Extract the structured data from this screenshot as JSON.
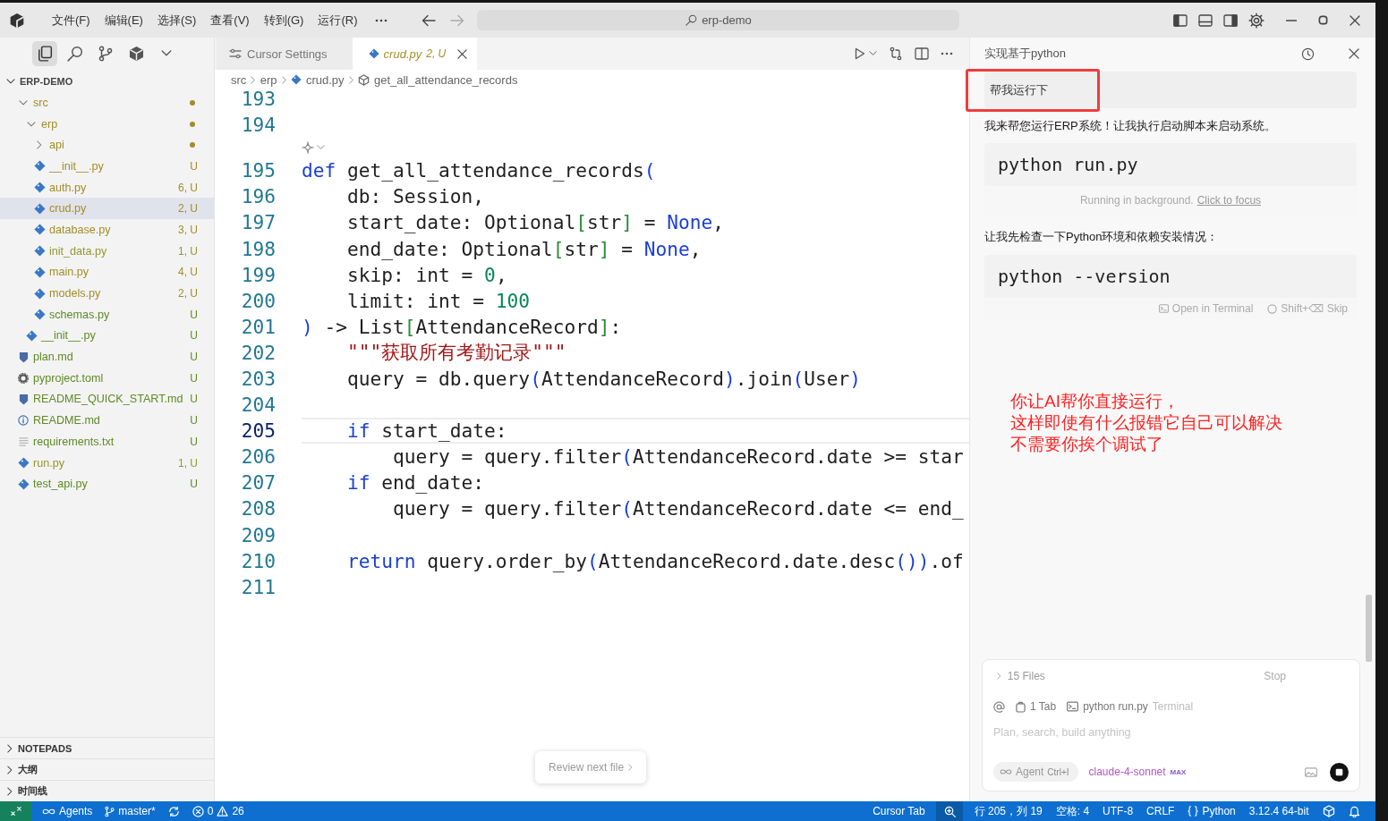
{
  "title_bar": {
    "menus": [
      "文件(F)",
      "编辑(E)",
      "选择(S)",
      "查看(V)",
      "转到(G)",
      "运行(R)"
    ],
    "search": {
      "value": "erp-demo"
    }
  },
  "activity_bar": {
    "items": [
      {
        "kind": "explorer",
        "selected": true
      },
      {
        "kind": "search",
        "selected": false
      },
      {
        "kind": "source-control",
        "selected": false
      },
      {
        "kind": "extensions",
        "selected": false
      },
      {
        "kind": "more",
        "selected": false
      }
    ]
  },
  "explorer": {
    "title": "ERP-DEMO",
    "expanded": true,
    "tree": [
      {
        "name": "src",
        "kind": "folder",
        "expanded": true,
        "selected": false,
        "color": "#a38d27",
        "children": [
          {
            "name": "erp",
            "kind": "folder",
            "expanded": true,
            "selected": false,
            "color": "#a38d27",
            "children": [
              {
                "name": "api",
                "kind": "folder",
                "expanded": false,
                "selected": false,
                "color": "#a38d27"
              },
              {
                "name": "__init__.py",
                "kind": "python",
                "badge": "U",
                "selected": false,
                "color": "#a38d27"
              },
              {
                "name": "auth.py",
                "kind": "python",
                "badge": "6, U",
                "selected": false,
                "color": "#a38d27"
              },
              {
                "name": "crud.py",
                "kind": "python",
                "badge": "2, U",
                "selected": true,
                "color": "#a38d27"
              },
              {
                "name": "database.py",
                "kind": "python",
                "badge": "3, U",
                "selected": false,
                "color": "#a38d27"
              },
              {
                "name": "init_data.py",
                "kind": "python",
                "badge": "1, U",
                "selected": false,
                "color": "#8f9a2c"
              },
              {
                "name": "main.py",
                "kind": "python",
                "badge": "4, U",
                "selected": false,
                "color": "#a38d27"
              },
              {
                "name": "models.py",
                "kind": "python",
                "badge": "2, U",
                "selected": false,
                "color": "#a38d27"
              },
              {
                "name": "schemas.py",
                "kind": "python",
                "badge": "U",
                "selected": false,
                "color": "#5f8a25"
              }
            ]
          },
          {
            "name": "__init__.py",
            "kind": "python",
            "badge": "U",
            "selected": false,
            "color": "#5f8a25"
          }
        ]
      },
      {
        "name": "plan.md",
        "kind": "markdown",
        "badge": "U",
        "selected": false,
        "color": "#5f8a25"
      },
      {
        "name": "pyproject.toml",
        "kind": "toml",
        "badge": "U",
        "selected": false,
        "color": "#5f8a25"
      },
      {
        "name": "README_QUICK_START.md",
        "kind": "markdown",
        "badge": "U",
        "selected": false,
        "color": "#5f8a25"
      },
      {
        "name": "README.md",
        "kind": "info",
        "badge": "U",
        "selected": false,
        "color": "#5f8a25"
      },
      {
        "name": "requirements.txt",
        "kind": "text",
        "badge": "U",
        "selected": false,
        "color": "#5f8a25"
      },
      {
        "name": "run.py",
        "kind": "python",
        "badge": "1, U",
        "selected": false,
        "color": "#8f9a2c"
      },
      {
        "name": "test_api.py",
        "kind": "python",
        "badge": "U",
        "selected": false,
        "color": "#5f8a25"
      }
    ]
  },
  "sections": [
    {
      "label": "NOTEPADS",
      "expanded": false
    },
    {
      "label": "大纲",
      "expanded": false
    },
    {
      "label": "时间线",
      "expanded": false
    }
  ],
  "editor": {
    "tabs": [
      {
        "kind": "settings",
        "label": "Cursor Settings",
        "selected": false,
        "preview": false
      },
      {
        "kind": "python",
        "label": "crud.py",
        "badge": "2, U",
        "selected": true,
        "preview": true,
        "color": "#a38d27"
      }
    ],
    "breadcrumb": [
      {
        "kind": "folder",
        "label": "src"
      },
      {
        "kind": "folder",
        "label": "erp"
      },
      {
        "kind": "python",
        "label": "crud.py"
      },
      {
        "kind": "method",
        "label": "get_all_attendance_records"
      }
    ],
    "lines": [
      {
        "kind": "code",
        "number": "193",
        "current": false
      },
      {
        "kind": "code",
        "number": "194",
        "current": false
      },
      {
        "kind": "lens"
      },
      {
        "kind": "code",
        "number": "195",
        "current": false,
        "tokens": [
          {
            "kind": "kw",
            "text": "def"
          },
          {
            "kind": "plain",
            "text": " get_all_attendance_records"
          },
          {
            "kind": "paren",
            "text": "("
          }
        ]
      },
      {
        "kind": "code",
        "number": "196",
        "current": false,
        "tokens": [
          {
            "kind": "plain",
            "text": "    db: Session,"
          }
        ]
      },
      {
        "kind": "code",
        "number": "197",
        "current": false,
        "tokens": [
          {
            "kind": "plain",
            "text": "    start_date: Optional"
          },
          {
            "kind": "bracket",
            "text": "["
          },
          {
            "kind": "plain",
            "text": "str"
          },
          {
            "kind": "bracket",
            "text": "]"
          },
          {
            "kind": "plain",
            "text": " = "
          },
          {
            "kind": "kw",
            "text": "None"
          },
          {
            "kind": "plain",
            "text": ","
          }
        ]
      },
      {
        "kind": "code",
        "number": "198",
        "current": false,
        "tokens": [
          {
            "kind": "plain",
            "text": "    end_date: Optional"
          },
          {
            "kind": "bracket",
            "text": "["
          },
          {
            "kind": "plain",
            "text": "str"
          },
          {
            "kind": "bracket",
            "text": "]"
          },
          {
            "kind": "plain",
            "text": " = "
          },
          {
            "kind": "kw",
            "text": "None"
          },
          {
            "kind": "plain",
            "text": ","
          }
        ]
      },
      {
        "kind": "code",
        "number": "199",
        "current": false,
        "tokens": [
          {
            "kind": "plain",
            "text": "    skip: int = "
          },
          {
            "kind": "num",
            "text": "0"
          },
          {
            "kind": "plain",
            "text": ","
          }
        ]
      },
      {
        "kind": "code",
        "number": "200",
        "current": false,
        "tokens": [
          {
            "kind": "plain",
            "text": "    limit: int = "
          },
          {
            "kind": "num",
            "text": "100"
          }
        ]
      },
      {
        "kind": "code",
        "number": "201",
        "current": false,
        "tokens": [
          {
            "kind": "paren",
            "text": ")"
          },
          {
            "kind": "plain",
            "text": " -> List"
          },
          {
            "kind": "bracket",
            "text": "["
          },
          {
            "kind": "plain",
            "text": "AttendanceRecord"
          },
          {
            "kind": "bracket",
            "text": "]"
          },
          {
            "kind": "plain",
            "text": ":"
          }
        ]
      },
      {
        "kind": "code",
        "number": "202",
        "current": false,
        "tokens": [
          {
            "kind": "str",
            "text": "    \"\"\"获取所有考勤记录\"\"\""
          }
        ]
      },
      {
        "kind": "code",
        "number": "203",
        "current": false,
        "tokens": [
          {
            "kind": "plain",
            "text": "    query = db.query"
          },
          {
            "kind": "paren",
            "text": "("
          },
          {
            "kind": "plain",
            "text": "AttendanceRecord"
          },
          {
            "kind": "paren",
            "text": ")"
          },
          {
            "kind": "plain",
            "text": ".join"
          },
          {
            "kind": "paren",
            "text": "("
          },
          {
            "kind": "plain",
            "text": "User"
          },
          {
            "kind": "paren",
            "text": ")"
          }
        ]
      },
      {
        "kind": "code",
        "number": "204",
        "current": false
      },
      {
        "kind": "code",
        "number": "205",
        "current": true,
        "tokens": [
          {
            "kind": "kw",
            "text": "    if"
          },
          {
            "kind": "plain",
            "text": " start_date:"
          }
        ]
      },
      {
        "kind": "code",
        "number": "206",
        "current": false,
        "tokens": [
          {
            "kind": "plain",
            "text": "        query = query.filter"
          },
          {
            "kind": "paren",
            "text": "("
          },
          {
            "kind": "plain",
            "text": "AttendanceRecord.date >= star"
          }
        ]
      },
      {
        "kind": "code",
        "number": "207",
        "current": false,
        "tokens": [
          {
            "kind": "kw",
            "text": "    if"
          },
          {
            "kind": "plain",
            "text": " end_date:"
          }
        ]
      },
      {
        "kind": "code",
        "number": "208",
        "current": false,
        "tokens": [
          {
            "kind": "plain",
            "text": "        query = query.filter"
          },
          {
            "kind": "paren",
            "text": "("
          },
          {
            "kind": "plain",
            "text": "AttendanceRecord.date <= end_"
          }
        ]
      },
      {
        "kind": "code",
        "number": "209",
        "current": false
      },
      {
        "kind": "code",
        "number": "210",
        "current": false,
        "tokens": [
          {
            "kind": "kw",
            "text": "    return"
          },
          {
            "kind": "plain",
            "text": " query.order_by"
          },
          {
            "kind": "paren",
            "text": "("
          },
          {
            "kind": "plain",
            "text": "AttendanceRecord.date.desc"
          },
          {
            "kind": "paren",
            "text": "()"
          },
          {
            "kind": "paren",
            "text": ")"
          },
          {
            "kind": "plain",
            "text": ".of"
          }
        ]
      },
      {
        "kind": "code",
        "number": "211",
        "current": false
      }
    ],
    "review_button": "Review next file"
  },
  "chat": {
    "title": "实现基于python",
    "messages": [
      {
        "kind": "user",
        "text": "帮我运行下"
      },
      {
        "kind": "assistant",
        "text": "我来帮您运行ERP系统！让我执行启动脚本来启动系统。"
      },
      {
        "kind": "command",
        "command": "python run.py",
        "status": "Running in background.",
        "link": "Click to focus"
      },
      {
        "kind": "assistant",
        "text": "让我先检查一下Python环境和依赖安装情况："
      },
      {
        "kind": "command",
        "command": "python --version",
        "actions": [
          {
            "kind": "terminal",
            "label": "Open in Terminal"
          },
          {
            "kind": "skip",
            "label": "Shift+⌫ Skip"
          }
        ]
      }
    ],
    "annotation": {
      "lines": [
        "你让AI帮你直接运行，",
        "这样即使有什么报错它自己可以解决",
        "不需要你挨个调试了"
      ]
    },
    "composer": {
      "files": "15 Files",
      "stop": "Stop",
      "context": [
        {
          "kind": "tab",
          "label": "1 Tab"
        },
        {
          "kind": "terminal",
          "label": "python run.py",
          "note": "Terminal"
        }
      ],
      "placeholder": "Plan, search, build anything",
      "mode": {
        "label": "Agent",
        "shortcut": "Ctrl+I"
      },
      "model": {
        "name": "claude-4-sonnet",
        "badge": "MAX"
      }
    }
  },
  "status_bar": {
    "left": [
      {
        "kind": "remote"
      },
      {
        "kind": "agents",
        "label": "Agents"
      },
      {
        "kind": "branch",
        "label": "master*"
      },
      {
        "kind": "sync"
      },
      {
        "kind": "problems",
        "errors": "0",
        "warnings": "26"
      }
    ],
    "right": [
      {
        "kind": "text",
        "label": "Cursor Tab"
      },
      {
        "kind": "zoom"
      },
      {
        "kind": "text",
        "label": "行 205，列 19"
      },
      {
        "kind": "text",
        "label": "空格: 4"
      },
      {
        "kind": "text",
        "label": "UTF-8"
      },
      {
        "kind": "text",
        "label": "CRLF"
      },
      {
        "kind": "language",
        "label": "Python"
      },
      {
        "kind": "text",
        "label": "3.12.4 64-bit"
      },
      {
        "kind": "cube"
      },
      {
        "kind": "bell"
      }
    ]
  }
}
